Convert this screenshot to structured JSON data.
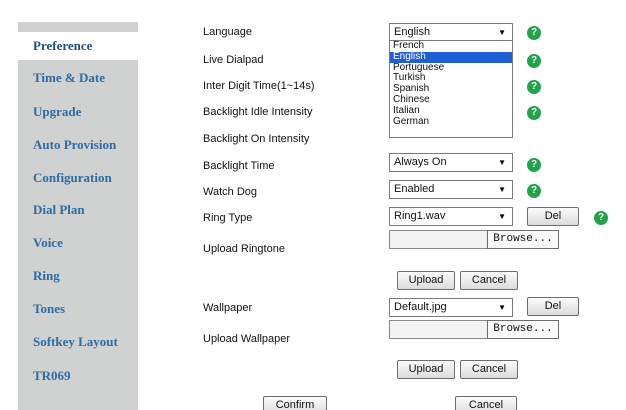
{
  "sidebar": {
    "items": [
      {
        "label": "Preference"
      },
      {
        "label": "Time & Date"
      },
      {
        "label": "Upgrade"
      },
      {
        "label": "Auto Provision"
      },
      {
        "label": "Configuration"
      },
      {
        "label": "Dial Plan"
      },
      {
        "label": "Voice"
      },
      {
        "label": "Ring"
      },
      {
        "label": "Tones"
      },
      {
        "label": "Softkey Layout"
      },
      {
        "label": "TR069"
      }
    ],
    "active": "Preference"
  },
  "settings": {
    "language": {
      "label": "Language",
      "value": "English"
    },
    "language_dropdown": {
      "options": [
        "French",
        "English",
        "Portuguese",
        "Turkish",
        "Spanish",
        "Chinese",
        "Italian",
        "German"
      ],
      "highlighted": "English"
    },
    "live_dialpad": {
      "label": "Live Dialpad"
    },
    "inter_digit_time": {
      "label": "Inter Digit Time(1~14s)"
    },
    "backlight_idle": {
      "label": "Backlight Idle Intensity"
    },
    "backlight_on": {
      "label": "Backlight On Intensity"
    },
    "backlight_time": {
      "label": "Backlight Time",
      "value": "Always On"
    },
    "watch_dog": {
      "label": "Watch Dog",
      "value": "Enabled"
    },
    "ring_type": {
      "label": "Ring Type",
      "value": "Ring1.wav",
      "del_label": "Del"
    },
    "upload_ringtone": {
      "label": "Upload Ringtone",
      "browse_label": "Browse...",
      "upload_label": "Upload",
      "cancel_label": "Cancel"
    },
    "wallpaper": {
      "label": "Wallpaper",
      "value": "Default.jpg",
      "del_label": "Del"
    },
    "upload_wallpaper": {
      "label": "Upload Wallpaper",
      "browse_label": "Browse...",
      "upload_label": "Upload",
      "cancel_label": "Cancel"
    }
  },
  "footer": {
    "confirm_label": "Confirm",
    "cancel_label": "Cancel"
  },
  "help_icon": "?",
  "colors": {
    "sidebar_bg": "#d0d2d2",
    "nav_text": "#2f6aa1",
    "help_green": "#21a34a",
    "highlight": "#1f5fd6"
  }
}
